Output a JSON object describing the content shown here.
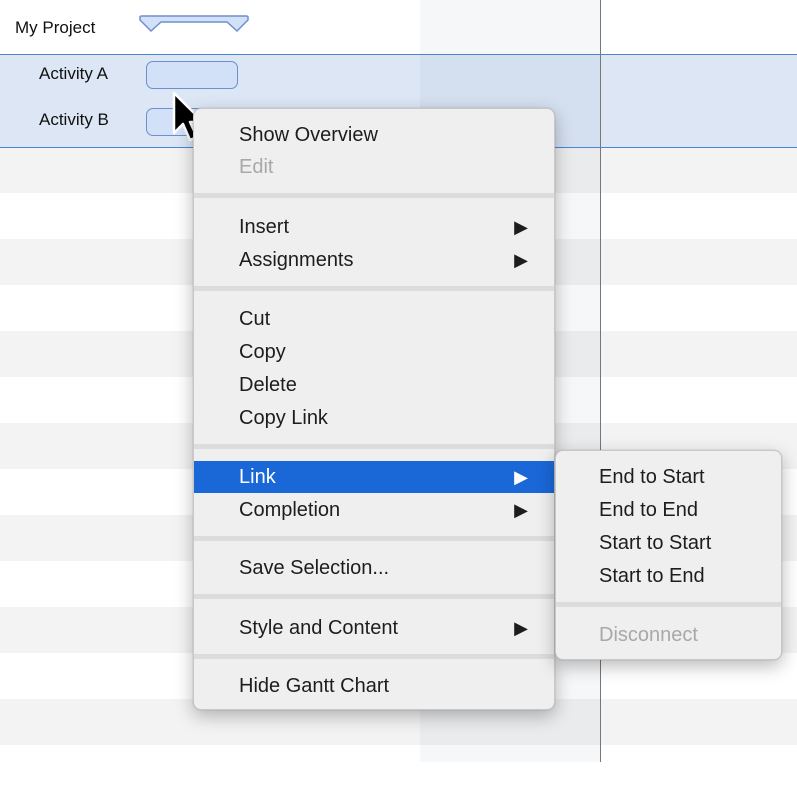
{
  "gantt": {
    "rows": [
      {
        "label": "My Project"
      },
      {
        "label": "Activity A"
      },
      {
        "label": "Activity B"
      }
    ]
  },
  "context_menu": {
    "items": [
      {
        "label": "Show Overview",
        "disabled": false
      },
      {
        "label": "Edit",
        "disabled": true
      },
      {
        "label": "Insert",
        "arrow": "▶"
      },
      {
        "label": "Assignments",
        "arrow": "▶"
      },
      {
        "label": "Cut"
      },
      {
        "label": "Copy"
      },
      {
        "label": "Delete"
      },
      {
        "label": "Copy Link"
      },
      {
        "label": "Link",
        "arrow": "▶",
        "highlighted": true
      },
      {
        "label": "Completion",
        "arrow": "▶"
      },
      {
        "label": "Save Selection..."
      },
      {
        "label": "Style and Content",
        "arrow": "▶"
      },
      {
        "label": "Hide Gantt Chart"
      }
    ]
  },
  "submenu": {
    "items": [
      {
        "label": "End to Start"
      },
      {
        "label": "End to End"
      },
      {
        "label": "Start to Start"
      },
      {
        "label": "Start to End"
      },
      {
        "label": "Disconnect",
        "disabled": true
      }
    ]
  },
  "colors": {
    "highlight": "#1a67d8",
    "selection": "#dce6f5",
    "bar_fill": "#d3e1f8",
    "bar_border": "#6d8fce"
  }
}
